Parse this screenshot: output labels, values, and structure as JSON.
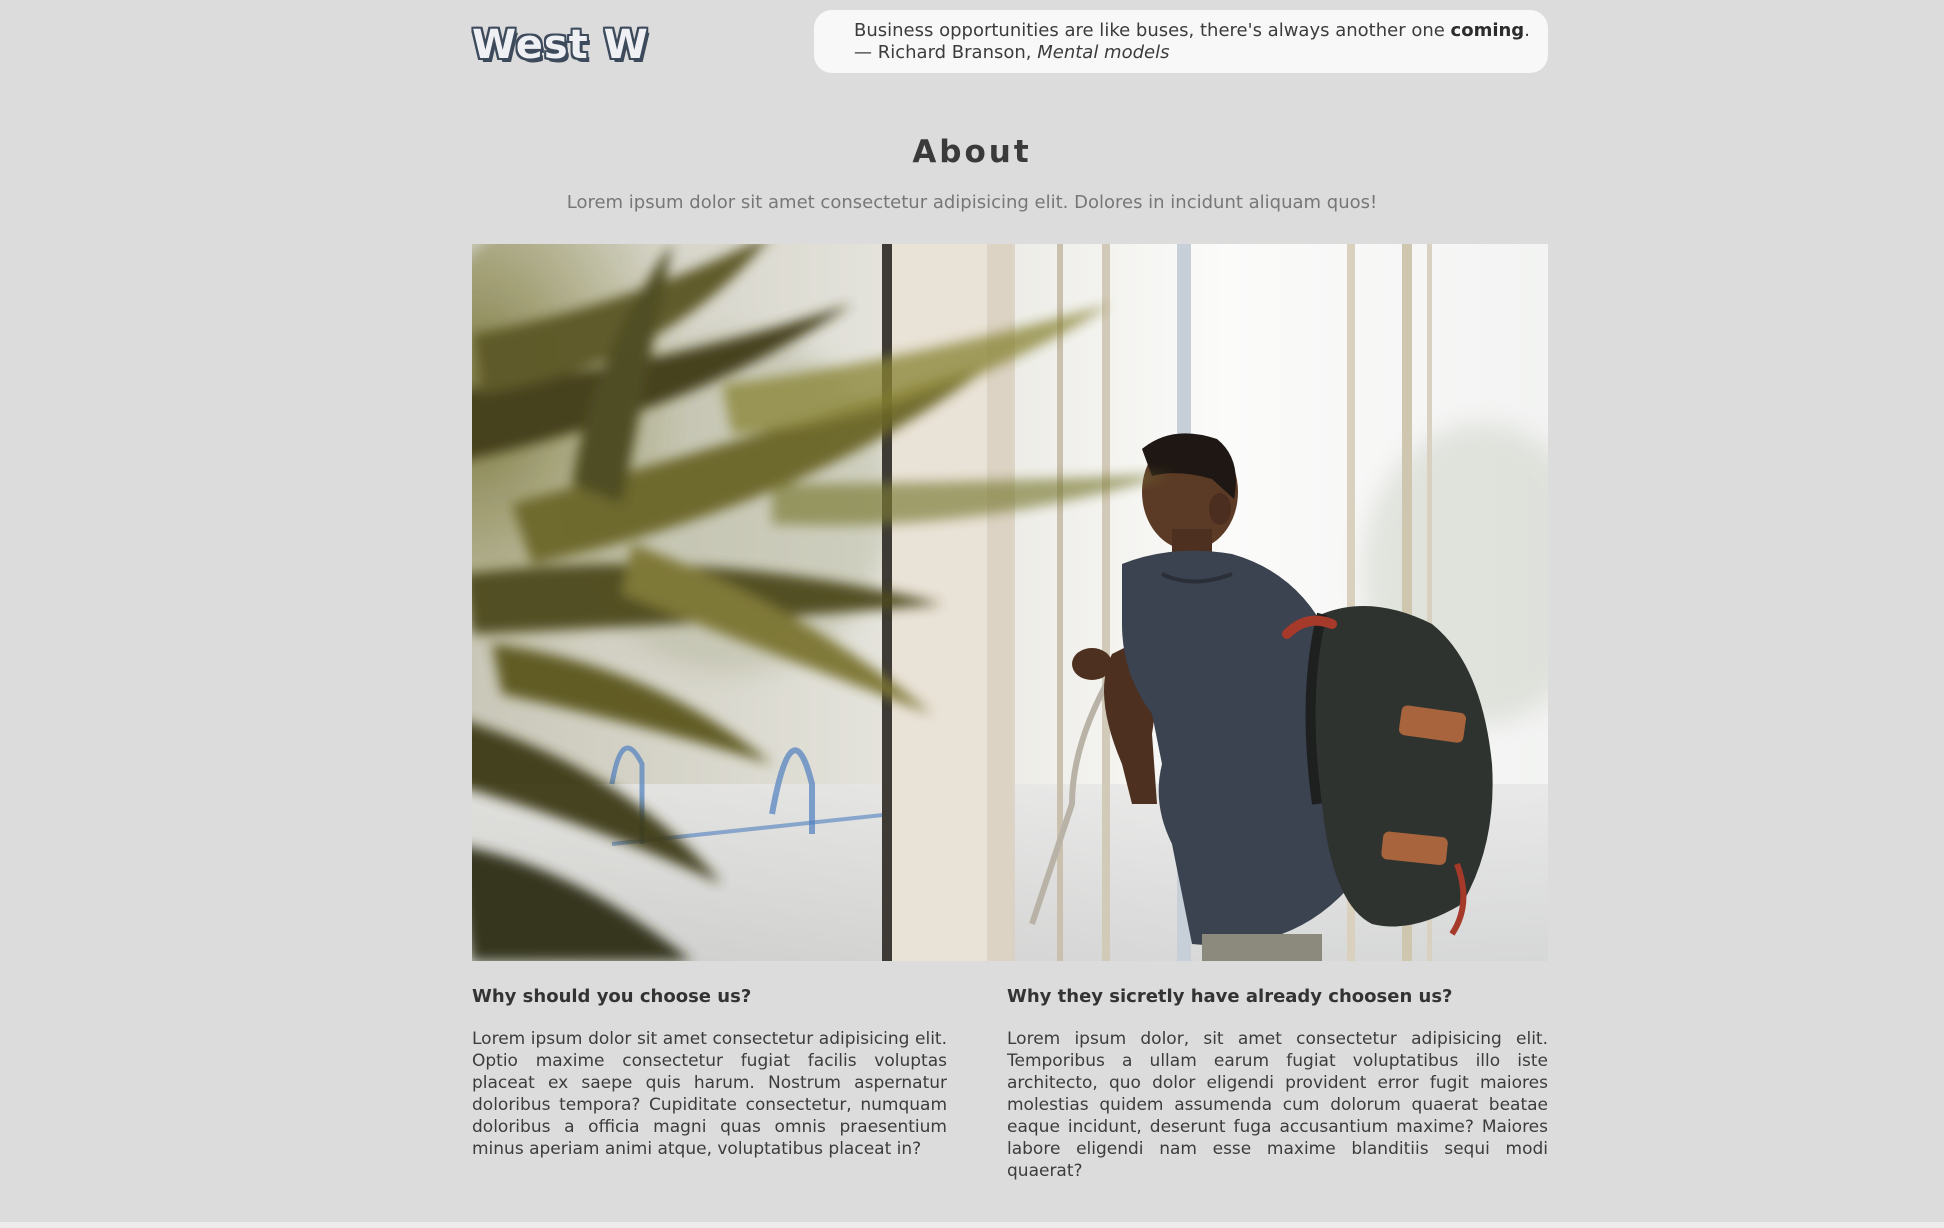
{
  "header": {
    "logo_text": "West W",
    "quote": {
      "text_before": "Business opportunities are like buses, there's always another one ",
      "text_bold": "coming",
      "text_after": ".",
      "attribution_prefix": "— Richard Branson, ",
      "attribution_source": "Mental models"
    }
  },
  "about": {
    "title": "About",
    "subtitle": "Lorem ipsum dolor sit amet consectetur adipisicing elit. Dolores in incidunt aliquam quos!"
  },
  "columns": {
    "left": {
      "heading": "Why should you choose us?",
      "body": "Lorem ipsum dolor sit amet consectetur adipisicing elit. Optio maxime consectetur fugiat facilis voluptas placeat ex saepe quis harum. Nostrum aspernatur doloribus tempora? Cupiditate consectetur, numquam doloribus a officia magni quas omnis praesentium minus aperiam animi atque, voluptatibus placeat in?"
    },
    "right": {
      "heading": "Why they sicretly have already choosen us?",
      "body": "Lorem ipsum dolor, sit amet consectetur adipisicing elit. Temporibus a ullam earum fugiat voluptatibus illo iste architecto, quo dolor eligendi provident error fugit maiores molestias quidem assumenda cum dolorum quaerat beatae eaque incidunt, deserunt fuga accusantium maxime? Maiores labore eligendi nam esse maxime blanditiis sequi modi quaerat?"
    }
  }
}
